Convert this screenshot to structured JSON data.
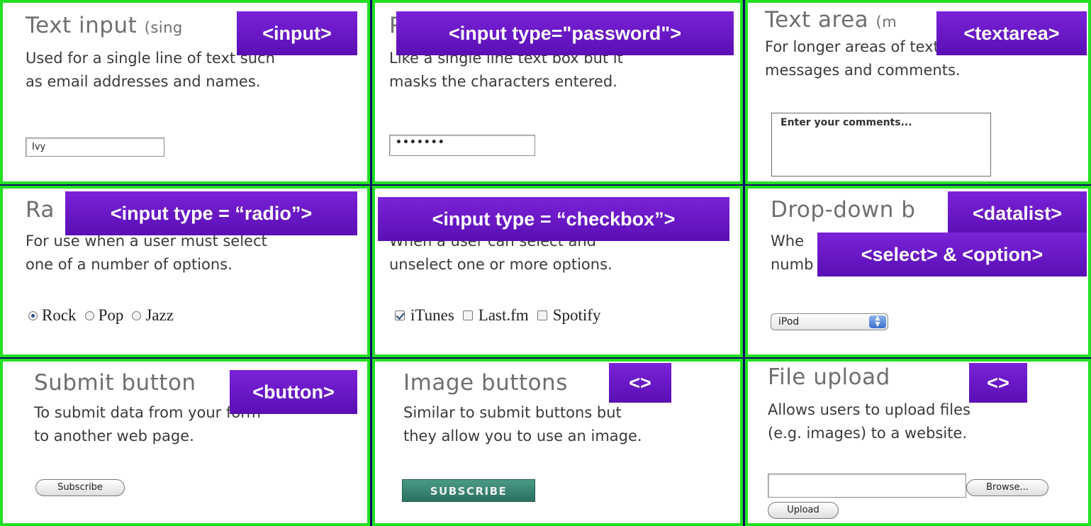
{
  "panels": {
    "text_input": {
      "title": "Text input",
      "title_small": "(sing",
      "tag": "<input>",
      "desc_lines": [
        "Used for a single line of text such",
        "as email addresses and names."
      ],
      "value": "Ivy"
    },
    "password": {
      "title": "P",
      "tag": "<input type=\"password\">",
      "desc_lines": [
        "Like a single line text box but it",
        "masks the characters entered."
      ],
      "value": "•••••••"
    },
    "text_area": {
      "title": "Text area",
      "title_small": "(m",
      "tag": "<textarea>",
      "desc_lines": [
        "For longer areas of text, such as",
        "messages and comments."
      ],
      "value": "Enter your comments..."
    },
    "radio": {
      "title": "Ra",
      "tag": "<input type = “radio”>",
      "desc_lines": [
        "For use when a user must select",
        "one of a number of options."
      ],
      "options": [
        {
          "label": "Rock",
          "selected": true
        },
        {
          "label": "Pop",
          "selected": false
        },
        {
          "label": "Jazz",
          "selected": false
        }
      ]
    },
    "checkbox": {
      "tag": "<input type = “checkbox”>",
      "desc_lines": [
        "When a user can select and",
        "unselect one or more options."
      ],
      "options": [
        {
          "label": "iTunes",
          "checked": true
        },
        {
          "label": "Last.fm",
          "checked": false
        },
        {
          "label": "Spotify",
          "checked": false
        }
      ]
    },
    "dropdown": {
      "title": "Drop-down b",
      "tag_datalist": "<datalist>",
      "tag_select": "<select> & <option>",
      "desc_lines": [
        "Whe",
        "numb"
      ],
      "selected": "iPod"
    },
    "submit": {
      "title": "Submit button",
      "tag": "<button>",
      "desc_lines": [
        "To submit data from your form",
        "to another web page."
      ],
      "button_label": "Subscribe"
    },
    "image_buttons": {
      "title": "Image buttons",
      "tag": "<>",
      "desc_lines": [
        "Similar to submit buttons but",
        "they allow you to use an image."
      ],
      "button_label": "SUBSCRIBE"
    },
    "file_upload": {
      "title": "File upload",
      "tag": "<>",
      "desc_lines": [
        "Allows users to upload files",
        "(e.g. images) to a website."
      ],
      "browse_label": "Browse...",
      "upload_label": "Upload"
    }
  },
  "colors": {
    "background": "#0a0a66",
    "panel_border": "#22e022",
    "tag_fill": "#6a18c8",
    "tag_text": "#ffffff"
  }
}
